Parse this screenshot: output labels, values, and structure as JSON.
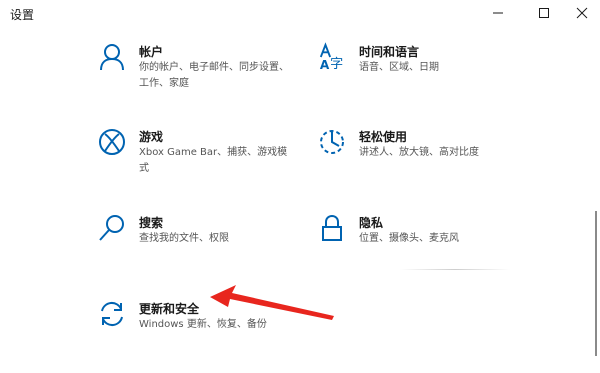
{
  "window": {
    "title": "设置"
  },
  "controls": {
    "minimize_icon": "minimize-icon",
    "maximize_icon": "maximize-icon",
    "close_icon": "close-icon"
  },
  "accent_color": "#0063b1",
  "annotation_color": "#e8261e",
  "tiles": [
    {
      "title": "帐户",
      "desc": "你的帐户、电子邮件、同步设置、工作、家庭",
      "icon": "person-icon"
    },
    {
      "title": "时间和语言",
      "desc": "语音、区域、日期",
      "icon": "time-language-icon"
    },
    {
      "title": "游戏",
      "desc": "Xbox Game Bar、捕获、游戏模式",
      "icon": "xbox-icon"
    },
    {
      "title": "轻松使用",
      "desc": "讲述人、放大镜、高对比度",
      "icon": "ease-of-access-icon"
    },
    {
      "title": "搜索",
      "desc": "查找我的文件、权限",
      "icon": "search-icon"
    },
    {
      "title": "隐私",
      "desc": "位置、摄像头、麦克风",
      "icon": "lock-icon"
    },
    {
      "title": "更新和安全",
      "desc": "Windows 更新、恢复、备份",
      "icon": "update-icon"
    }
  ]
}
